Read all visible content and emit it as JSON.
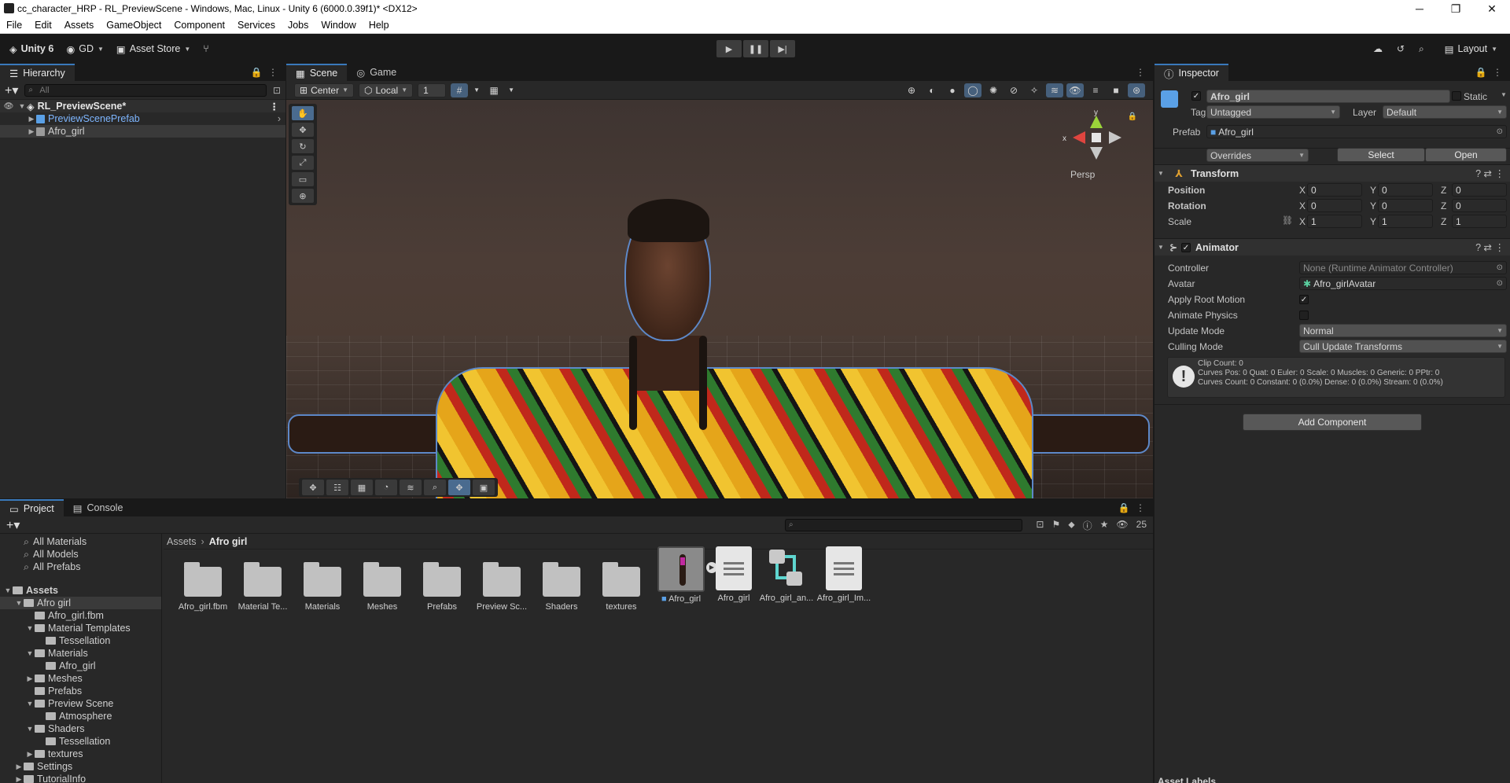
{
  "window": {
    "title": "cc_character_HRP - RL_PreviewScene - Windows, Mac, Linux - Unity 6 (6000.0.39f1)* <DX12>",
    "controls": [
      "─",
      "❐",
      "✕"
    ]
  },
  "menu": [
    "File",
    "Edit",
    "Assets",
    "GameObject",
    "Component",
    "Services",
    "Jobs",
    "Window",
    "Help"
  ],
  "toolbar": {
    "unity_label": "Unity 6",
    "account": "GD",
    "asset_store": "Asset Store",
    "layout": "Layout"
  },
  "hierarchy": {
    "tab": "Hierarchy",
    "search_placeholder": "All",
    "scene": "RL_PreviewScene*",
    "items": [
      "PreviewScenePrefab",
      "Afro_girl"
    ]
  },
  "scene": {
    "tabs": [
      "Scene",
      "Game"
    ],
    "pivot": "Center",
    "space": "Local",
    "snap": "1",
    "persp": "Persp",
    "gizmo_axis_x": "x",
    "gizmo_axis_y": "y"
  },
  "inspector": {
    "tab": "Inspector",
    "object_name": "Afro_girl",
    "static_label": "Static",
    "tag_label": "Tag",
    "tag_value": "Untagged",
    "layer_label": "Layer",
    "layer_value": "Default",
    "prefab_label": "Prefab",
    "prefab_value": "Afro_girl",
    "overrides": "Overrides",
    "select_btn": "Select",
    "open_btn": "Open",
    "transform": {
      "title": "Transform",
      "position_label": "Position",
      "rotation_label": "Rotation",
      "scale_label": "Scale",
      "x": "X",
      "y": "Y",
      "z": "Z",
      "position": [
        "0",
        "0",
        "0"
      ],
      "rotation": [
        "0",
        "0",
        "0"
      ],
      "scale": [
        "1",
        "1",
        "1"
      ]
    },
    "animator": {
      "title": "Animator",
      "controller_label": "Controller",
      "controller_value": "None (Runtime Animator Controller)",
      "avatar_label": "Avatar",
      "avatar_value": "Afro_girlAvatar",
      "apply_root_motion_label": "Apply Root Motion",
      "animate_physics_label": "Animate Physics",
      "update_mode_label": "Update Mode",
      "update_mode_value": "Normal",
      "culling_mode_label": "Culling Mode",
      "culling_mode_value": "Cull Update Transforms",
      "info_lines": [
        "Clip Count: 0",
        "Curves Pos: 0 Quat: 0 Euler: 0 Scale: 0 Muscles: 0 Generic: 0 PPtr: 0",
        "Curves Count: 0 Constant: 0 (0.0%) Dense: 0 (0.0%) Stream: 0 (0.0%)"
      ]
    },
    "add_component": "Add Component",
    "asset_labels": "Asset Labels"
  },
  "project": {
    "tabs": [
      "Project",
      "Console"
    ],
    "hidden_count": "25",
    "favorites": [
      "All Materials",
      "All Models",
      "All Prefabs"
    ],
    "tree": [
      {
        "label": "Assets",
        "depth": 0,
        "open": true
      },
      {
        "label": "Afro girl",
        "depth": 1,
        "open": true
      },
      {
        "label": "Afro_girl.fbm",
        "depth": 2,
        "open": false
      },
      {
        "label": "Material Templates",
        "depth": 2,
        "open": true
      },
      {
        "label": "Tessellation",
        "depth": 3,
        "open": false
      },
      {
        "label": "Materials",
        "depth": 2,
        "open": true
      },
      {
        "label": "Afro_girl",
        "depth": 3,
        "open": false
      },
      {
        "label": "Meshes",
        "depth": 2,
        "open": false
      },
      {
        "label": "Prefabs",
        "depth": 2,
        "open": false
      },
      {
        "label": "Preview Scene",
        "depth": 2,
        "open": true
      },
      {
        "label": "Atmosphere",
        "depth": 3,
        "open": false
      },
      {
        "label": "Shaders",
        "depth": 2,
        "open": true
      },
      {
        "label": "Tessellation",
        "depth": 3,
        "open": false
      },
      {
        "label": "textures",
        "depth": 2,
        "open": false
      },
      {
        "label": "Settings",
        "depth": 1,
        "open": false
      },
      {
        "label": "TutorialInfo",
        "depth": 1,
        "open": false
      }
    ],
    "breadcrumb": [
      "Assets",
      "Afro girl"
    ],
    "assets": [
      "Afro_girl.fbm",
      "Material Te...",
      "Materials",
      "Meshes",
      "Prefabs",
      "Preview Sc...",
      "Shaders",
      "textures",
      "Afro_girl",
      "Afro_girl",
      "Afro_girl_an...",
      "Afro_girl_Im..."
    ]
  }
}
